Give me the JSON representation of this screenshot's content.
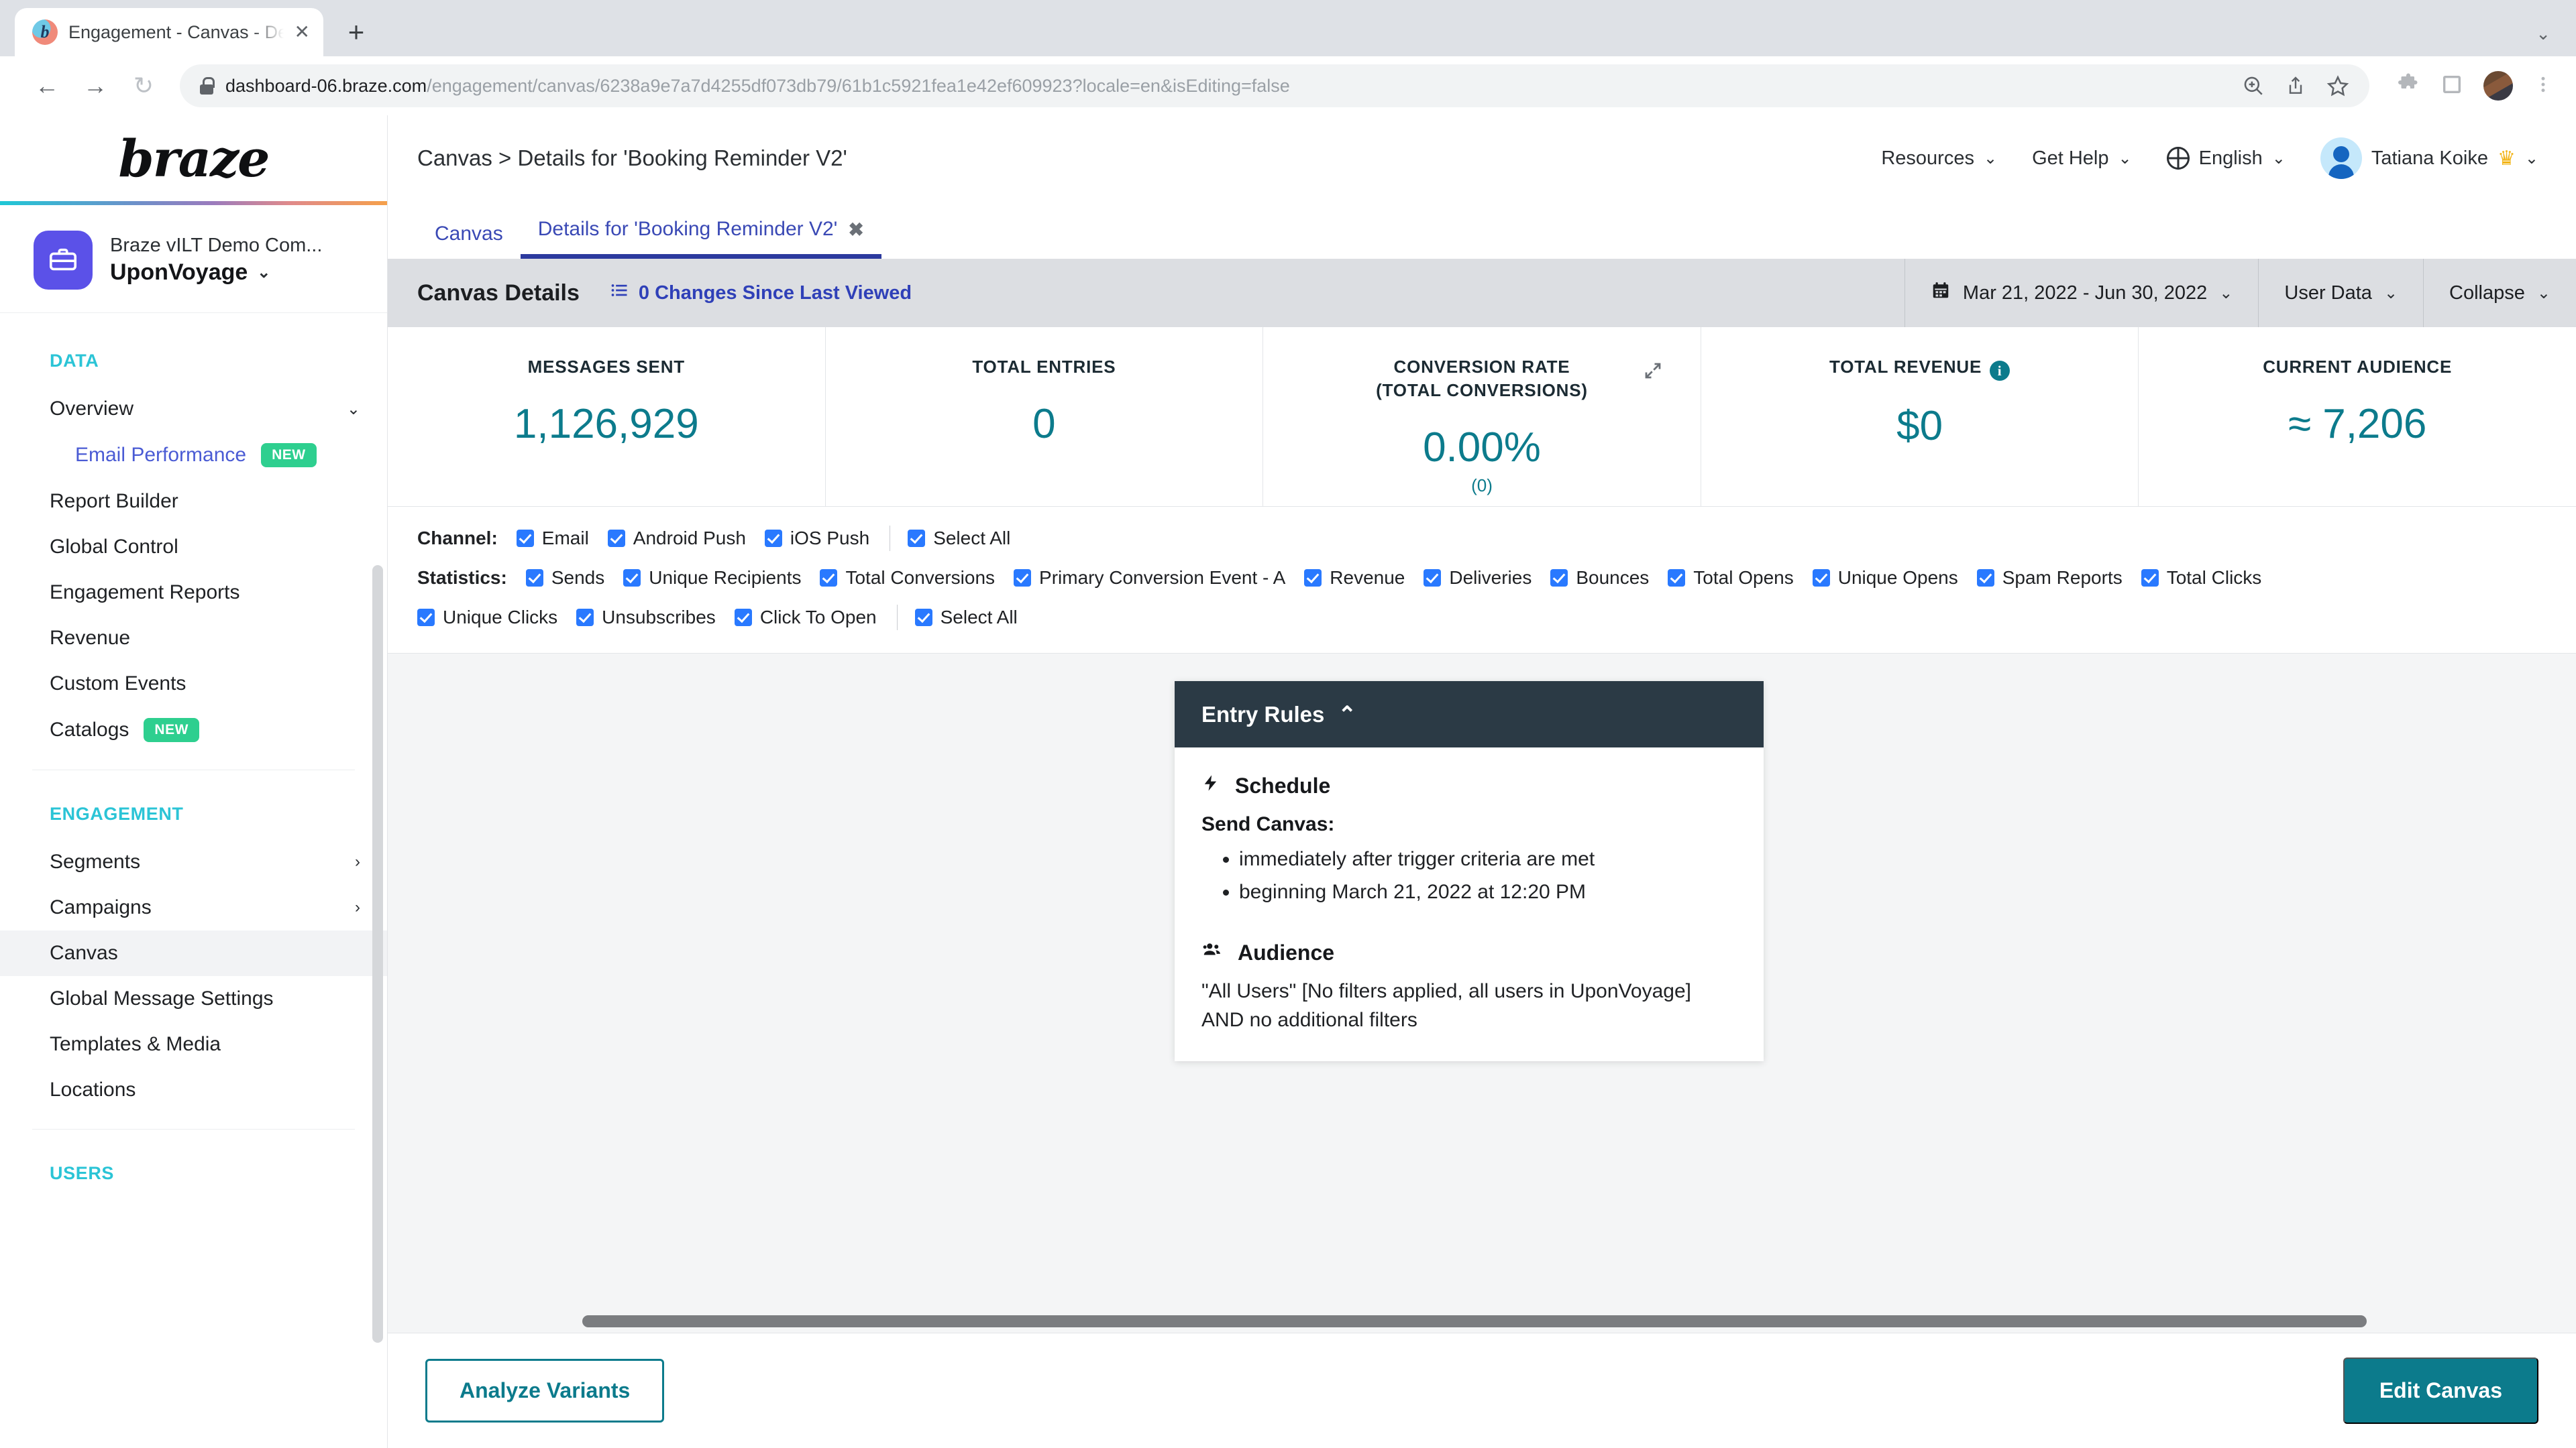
{
  "browser": {
    "tab_title": "Engagement - Canvas - Details",
    "tab_close": "✕",
    "new_tab": "+",
    "chrome_expand": "⌄",
    "back": "←",
    "forward": "→",
    "reload": "↻",
    "url_host": "dashboard-06.braze.com",
    "url_path": "/engagement/canvas/6238a9e7a7d4255df073db79/61b1c5921fea1e42ef609923?locale=en&isEditing=false",
    "icons": {
      "zoom": "zoom-icon",
      "share": "share-icon",
      "bookmark": "star-icon",
      "extensions": "puzzle-icon",
      "sidepanel": "side-panel-icon",
      "profile": "profile-avatar",
      "menu": "three-dot-menu"
    }
  },
  "sidebar": {
    "logo": "braze",
    "workspace": {
      "company": "Braze vILT Demo Com...",
      "name": "UponVoyage",
      "chevron": "⌄",
      "icon": "briefcase-icon"
    },
    "sections": [
      {
        "title": "DATA",
        "items": [
          {
            "label": "Overview",
            "chevron": "⌄",
            "badge": "",
            "active": false,
            "sub": false
          },
          {
            "label": "Email Performance",
            "chevron": "",
            "badge": "NEW",
            "active": false,
            "sub": true
          },
          {
            "label": "Report Builder",
            "chevron": "",
            "badge": "",
            "active": false,
            "sub": false
          },
          {
            "label": "Global Control",
            "chevron": "",
            "badge": "",
            "active": false,
            "sub": false
          },
          {
            "label": "Engagement Reports",
            "chevron": "",
            "badge": "",
            "active": false,
            "sub": false
          },
          {
            "label": "Revenue",
            "chevron": "",
            "badge": "",
            "active": false,
            "sub": false
          },
          {
            "label": "Custom Events",
            "chevron": "",
            "badge": "",
            "active": false,
            "sub": false
          },
          {
            "label": "Catalogs",
            "chevron": "",
            "badge": "NEW",
            "active": false,
            "sub": false
          }
        ]
      },
      {
        "title": "ENGAGEMENT",
        "items": [
          {
            "label": "Segments",
            "chevron": "›",
            "badge": "",
            "active": false,
            "sub": false
          },
          {
            "label": "Campaigns",
            "chevron": "›",
            "badge": "",
            "active": false,
            "sub": false
          },
          {
            "label": "Canvas",
            "chevron": "",
            "badge": "",
            "active": true,
            "sub": false
          },
          {
            "label": "Global Message Settings",
            "chevron": "",
            "badge": "",
            "active": false,
            "sub": false
          },
          {
            "label": "Templates & Media",
            "chevron": "",
            "badge": "",
            "active": false,
            "sub": false
          },
          {
            "label": "Locations",
            "chevron": "",
            "badge": "",
            "active": false,
            "sub": false
          }
        ]
      },
      {
        "title": "USERS",
        "items": []
      }
    ]
  },
  "topbar": {
    "breadcrumb": "Canvas > Details for 'Booking Reminder V2'",
    "resources": "Resources",
    "get_help": "Get Help",
    "language": "English",
    "user_name": "Tatiana Koike",
    "chevron": "⌄",
    "crown": "♛"
  },
  "tabs": [
    {
      "label": "Canvas",
      "active": false,
      "closable": false
    },
    {
      "label": "Details for 'Booking Reminder V2'",
      "active": true,
      "closable": true,
      "close": "✖"
    }
  ],
  "details_bar": {
    "title": "Canvas Details",
    "changes_link": "0 Changes Since Last Viewed",
    "list_icon": "list-icon",
    "date_range": "Mar 21, 2022 - Jun 30, 2022",
    "calendar_icon": "calendar-icon",
    "user_data": "User Data",
    "collapse": "Collapse",
    "chevron": "⌄"
  },
  "kpis": [
    {
      "label": "MESSAGES SENT",
      "value": "1,126,929",
      "sub": "",
      "info": false,
      "expand": false
    },
    {
      "label": "TOTAL ENTRIES",
      "value": "0",
      "sub": "",
      "info": false,
      "expand": false
    },
    {
      "label": "CONVERSION RATE",
      "label2": "(TOTAL CONVERSIONS)",
      "value": "0.00%",
      "sub": "(0)",
      "info": false,
      "expand": true
    },
    {
      "label": "TOTAL REVENUE",
      "value": "$0",
      "sub": "",
      "info": true,
      "expand": false
    },
    {
      "label": "CURRENT AUDIENCE",
      "value": "≈ 7,206",
      "sub": "",
      "info": false,
      "expand": false
    }
  ],
  "filters": {
    "channel_label": "Channel:",
    "channels": [
      "Email",
      "Android Push",
      "iOS Push"
    ],
    "channel_select_all": "Select All",
    "statistics_label": "Statistics:",
    "statistics_row1": [
      "Sends",
      "Unique Recipients",
      "Total Conversions",
      "Primary Conversion Event - A",
      "Revenue",
      "Deliveries",
      "Bounces",
      "Total Opens",
      "Unique Opens",
      "Spam Reports",
      "Total Clicks"
    ],
    "statistics_row2": [
      "Unique Clicks",
      "Unsubscribes",
      "Click To Open"
    ],
    "statistics_select_all": "Select All"
  },
  "entry_rules": {
    "title": "Entry Rules",
    "collapse_caret": "⌃",
    "schedule_title": "Schedule",
    "schedule_icon": "lightning-icon",
    "send_canvas_label": "Send Canvas:",
    "schedule_bullets": [
      "immediately after trigger criteria are met",
      "beginning March 21, 2022 at 12:20 PM"
    ],
    "audience_title": "Audience",
    "audience_icon": "people-icon",
    "audience_text": "\"All Users\" [No filters applied, all users in UponVoyage] AND no additional filters"
  },
  "bottom": {
    "analyze_variants": "Analyze Variants",
    "edit_canvas": "Edit Canvas"
  },
  "colors": {
    "teal": "#0c7b8c",
    "braze_blue": "#2f40b8",
    "accent_cyan": "#2bc4d6",
    "badge_green": "#2ecf8f",
    "dark_header": "#2b3a45"
  }
}
